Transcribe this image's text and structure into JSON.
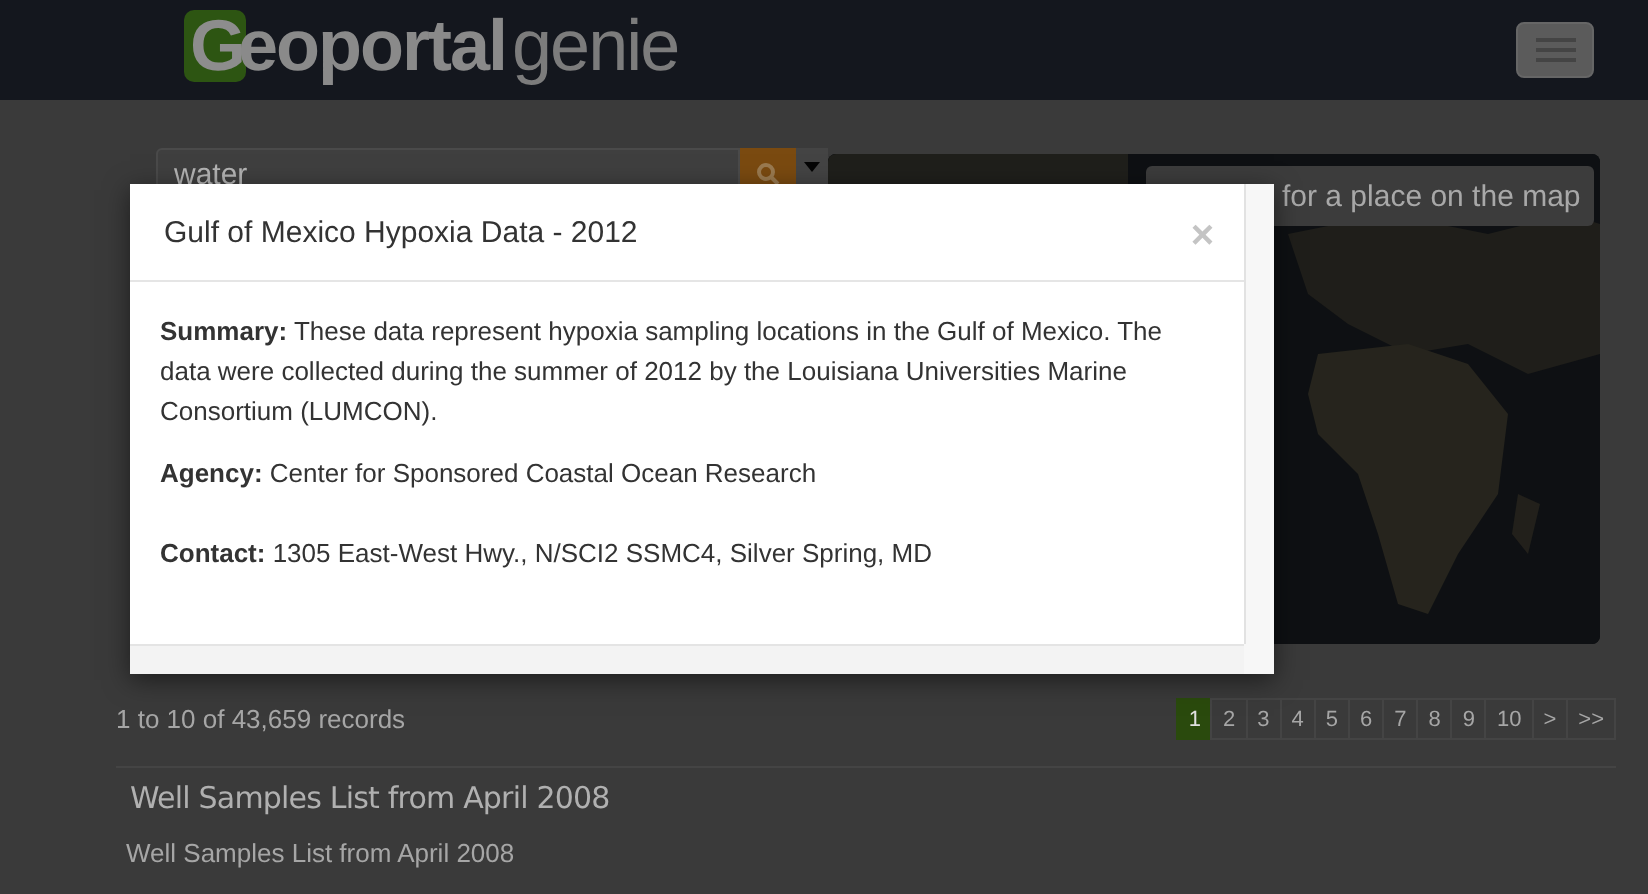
{
  "header": {
    "logo": {
      "initial": "G",
      "bold": "eoportal",
      "light": "genie"
    }
  },
  "search": {
    "value": "water"
  },
  "map": {
    "kind": "picture",
    "place_search": {
      "placeholder": "for a place on the map"
    }
  },
  "modal": {
    "title": "Gulf of Mexico Hypoxia Data - 2012",
    "close": "×",
    "fields": [
      {
        "label": "Summary:",
        "value": "These data represent hypoxia sampling locations in the Gulf of Mexico. The data were collected during the summer of 2012 by the Louisiana Universities Marine Consortium (LUMCON)."
      },
      {
        "label": "Agency:",
        "value": "Center for Sponsored Coastal Ocean Research"
      },
      {
        "label": "Contact:",
        "value": "1305 East-West Hwy., N/SCI2 SSMC4, Silver Spring, MD"
      }
    ]
  },
  "results": {
    "count": "1 to 10 of 43,659 records",
    "pages": [
      {
        "label": "1",
        "selected": true
      },
      {
        "label": "2",
        "selected": false
      },
      {
        "label": "3",
        "selected": false
      },
      {
        "label": "4",
        "selected": false
      },
      {
        "label": "5",
        "selected": false
      },
      {
        "label": "6",
        "selected": false
      },
      {
        "label": "7",
        "selected": false
      },
      {
        "label": "8",
        "selected": false
      },
      {
        "label": "9",
        "selected": false
      },
      {
        "label": "10",
        "selected": false
      },
      {
        "label": ">",
        "selected": false
      },
      {
        "label": ">>",
        "selected": false
      }
    ],
    "items": [
      {
        "title": "Well Samples List from April 2008",
        "description": "Well Samples List from April 2008"
      }
    ]
  }
}
